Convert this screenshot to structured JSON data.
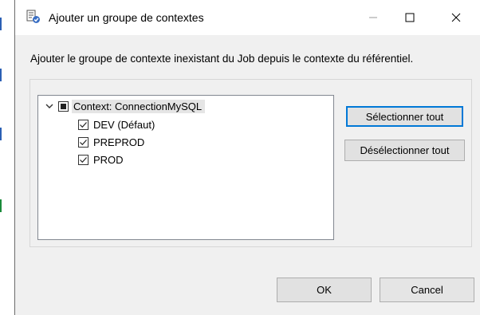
{
  "window": {
    "title": "Ajouter un groupe de contextes",
    "icon": "context-group-icon",
    "controls": {
      "minimize": "minimize-icon",
      "maximize": "maximize-icon",
      "close": "close-icon"
    }
  },
  "description": "Ajouter le groupe de contexte inexistant du Job depuis le contexte du référentiel.",
  "tree": {
    "root": {
      "label": "Context: ConnectionMySQL",
      "expanded": true,
      "state": "partial"
    },
    "children": [
      {
        "label": "DEV (Défaut)",
        "checked": true
      },
      {
        "label": "PREPROD",
        "checked": true
      },
      {
        "label": "PROD",
        "checked": true
      }
    ]
  },
  "buttons": {
    "select_all": "Sélectionner tout",
    "deselect_all": "Désélectionner tout",
    "ok": "OK",
    "cancel": "Cancel"
  },
  "colors": {
    "dialog_bg": "#f0f0f0",
    "accent": "#0078d7"
  }
}
